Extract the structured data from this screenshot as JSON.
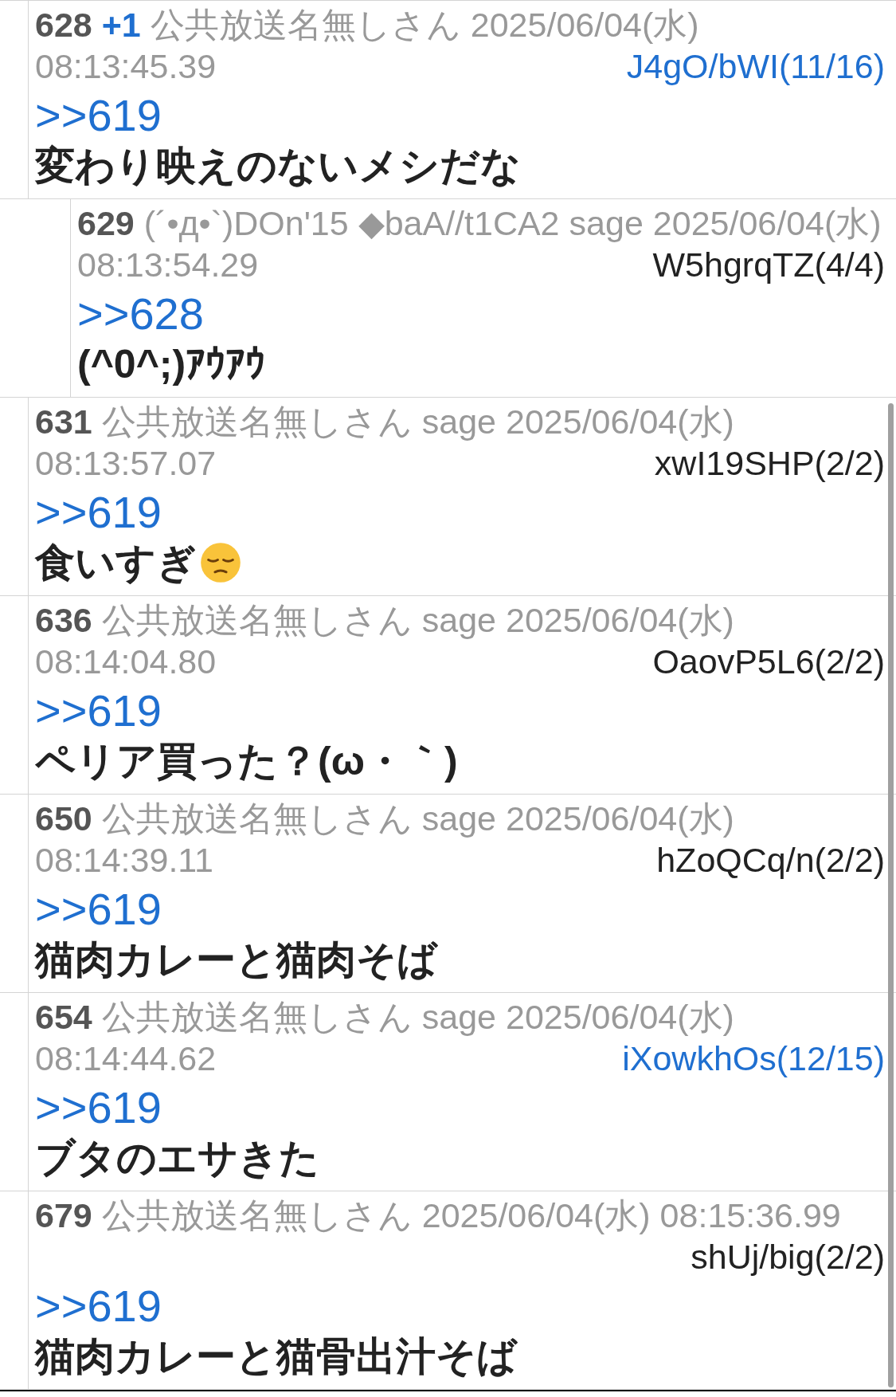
{
  "posts": [
    {
      "number": "628",
      "plus": "+1",
      "name": "公共放送名無しさん",
      "date": "2025/06/04(水)",
      "time": "08:13:45.39",
      "id": "J4gO/bWI(11/16)",
      "id_highlight": true,
      "anchor": ">>619",
      "body": "変わり映えのないメシだな",
      "children": [
        {
          "number": "629",
          "name": "(´•д•`)DOn'15 ◆baA//t1CA2",
          "mail": "sage",
          "date": "2025/06/04(水)",
          "time": "08:13:54.29",
          "id": "W5hgrqTZ(4/4)",
          "id_highlight": false,
          "anchor": ">>628",
          "body": "(^0^;)ｱｳｱｳ"
        }
      ]
    },
    {
      "number": "631",
      "name": "公共放送名無しさん",
      "mail": "sage",
      "date": "2025/06/04(水)",
      "time": "08:13:57.07",
      "id": "xwI19SHP(2/2)",
      "id_highlight": false,
      "anchor": ">>619",
      "body": "食いすぎ",
      "emoji": true
    },
    {
      "number": "636",
      "name": "公共放送名無しさん",
      "mail": "sage",
      "date": "2025/06/04(水)",
      "time": "08:14:04.80",
      "id": "OaovP5L6(2/2)",
      "id_highlight": false,
      "anchor": ">>619",
      "body": "ペリア買った？(ω・｀)"
    },
    {
      "number": "650",
      "name": "公共放送名無しさん",
      "mail": "sage",
      "date": "2025/06/04(水)",
      "time": "08:14:39.11",
      "id": "hZoQCq/n(2/2)",
      "id_highlight": false,
      "anchor": ">>619",
      "body": "猫肉カレーと猫肉そば"
    },
    {
      "number": "654",
      "name": "公共放送名無しさん",
      "mail": "sage",
      "date": "2025/06/04(水)",
      "time": "08:14:44.62",
      "id": "iXowkhOs(12/15)",
      "id_highlight": true,
      "anchor": ">>619",
      "body": "ブタのエサきた"
    },
    {
      "number": "679",
      "name": "公共放送名無しさん",
      "date": "2025/06/04(水)",
      "time": "08:15:36.99",
      "id": "shUj/big(2/2)",
      "id_highlight": false,
      "anchor": ">>619",
      "body": "猫肉カレーと猫骨出汁そば"
    }
  ]
}
